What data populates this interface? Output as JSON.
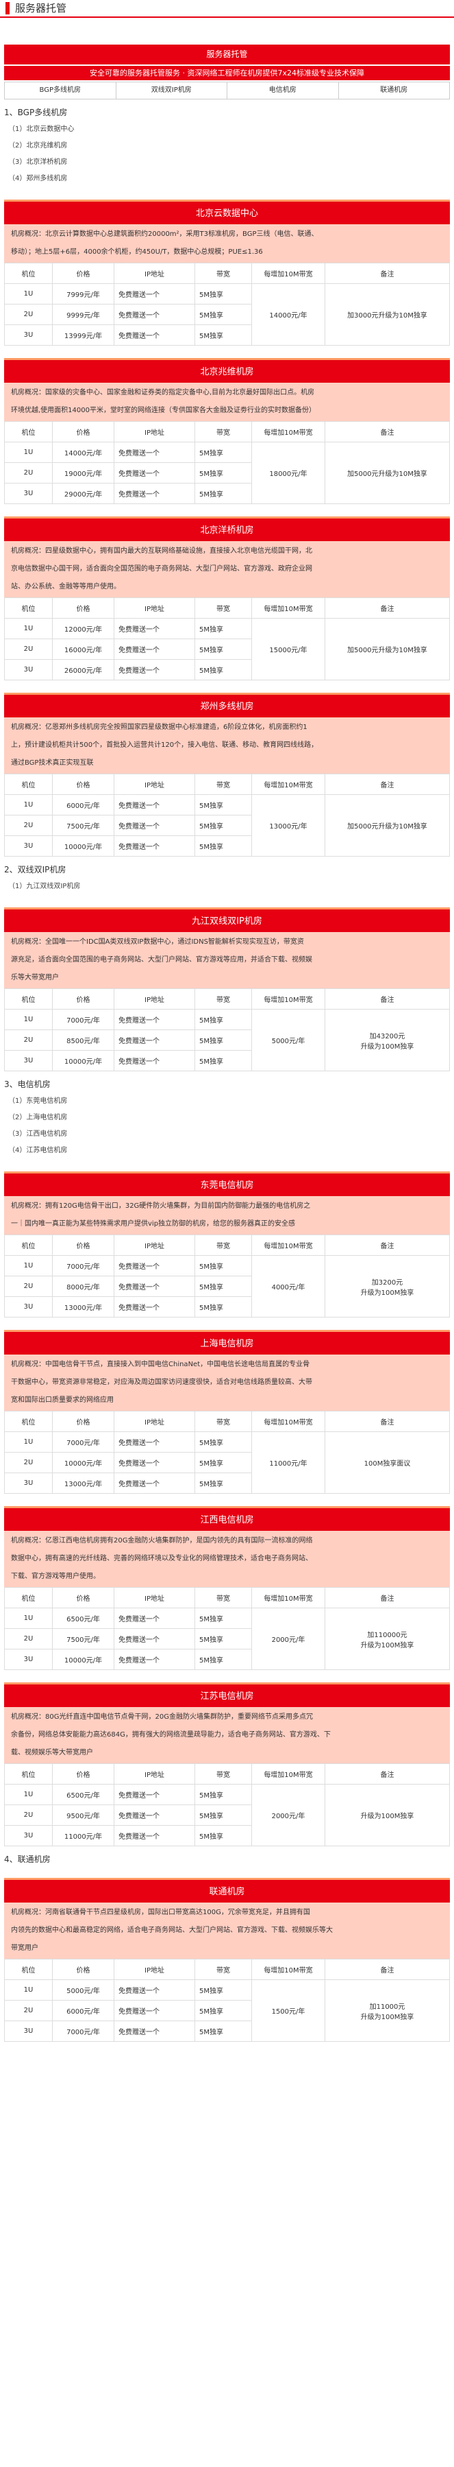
{
  "page": {
    "title": "服务器托管"
  },
  "intro": {
    "heading": "服务器托管",
    "tagline": "安全可靠的服务器托管服务 · 资深网络工程师在机房提供7x24标准级专业技术保障",
    "tabs": [
      "BGP多线机房",
      "双线双IP机房",
      "电信机房",
      "联通机房"
    ]
  },
  "table_headers": [
    "机位",
    "价格",
    "IP地址",
    "带宽",
    "每增加10M带宽",
    "备注"
  ],
  "groups": [
    {
      "title": "1、BGP多线机房",
      "items": [
        "（1）北京云数据中心",
        "（2）北京兆维机房",
        "（3）北京洋桥机房",
        "（4）郑州多线机房"
      ],
      "rooms": [
        {
          "name": "北京云数据中心",
          "desc": [
            "机房概况：北京云计算数据中心总建筑面积约20000m²，采用T3标准机房，BGP三线（电信、联通、",
            "移动）；地上5层+6层，4000余个机柜，约450U/T，数据中心总规模；PUE≤1.36"
          ],
          "rows": [
            {
              "pos": "1U",
              "price": "7999元/年",
              "ip": "免费赠送一个",
              "bw": "5M独享"
            },
            {
              "pos": "2U",
              "price": "9999元/年",
              "ip": "免费赠送一个",
              "bw": "5M独享"
            },
            {
              "pos": "3U",
              "price": "13999元/年",
              "ip": "免费赠送一个",
              "bw": "5M独享"
            }
          ],
          "add": "14000元/年",
          "note": [
            "加3000元升级为10M独享"
          ]
        },
        {
          "name": "北京兆维机房",
          "desc": [
            "机房概况：国家级的灾备中心、国家金融和证券类的指定灾备中心,目前为北京最好国际出口点。机房",
            "环境优越,使用面积14000平米，堂时室的网络连接（专供国家各大金融及证劵行业的实时数据备份）"
          ],
          "rows": [
            {
              "pos": "1U",
              "price": "14000元/年",
              "ip": "免费赠送一个",
              "bw": "5M独享"
            },
            {
              "pos": "2U",
              "price": "19000元/年",
              "ip": "免费赠送一个",
              "bw": "5M独享"
            },
            {
              "pos": "3U",
              "price": "29000元/年",
              "ip": "免费赠送一个",
              "bw": "5M独享"
            }
          ],
          "add": "18000元/年",
          "note": [
            "加5000元升级为10M独享"
          ]
        },
        {
          "name": "北京洋桥机房",
          "desc": [
            "机房概况：四星级数据中心，拥有国内最大的互联网络基础设施，直接接入北京电信光缆国干网，北",
            "京电信数据中心国干网，适合面向全国范围的电子商务网站、大型门户网站、官方游戏、政府企业网",
            "站、办公系统、金融等等用户使用。"
          ],
          "rows": [
            {
              "pos": "1U",
              "price": "12000元/年",
              "ip": "免费赠送一个",
              "bw": "5M独享"
            },
            {
              "pos": "2U",
              "price": "16000元/年",
              "ip": "免费赠送一个",
              "bw": "5M独享"
            },
            {
              "pos": "3U",
              "price": "26000元/年",
              "ip": "免费赠送一个",
              "bw": "5M独享"
            }
          ],
          "add": "15000元/年",
          "note": [
            "加5000元升级为10M独享"
          ]
        },
        {
          "name": "郑州多线机房",
          "desc": [
            "机房概况：亿恩郑州多线机房完全按照国家四星级数据中心标准建造，6阶段立体化，机房面积约1",
            "上，预计建设机柜共计500个，首批投入运营共计120个，接入电信、联通、移动、教育网四线线路，",
            "通过BGP技术真正实现互联"
          ],
          "rows": [
            {
              "pos": "1U",
              "price": "6000元/年",
              "ip": "免费赠送一个",
              "bw": "5M独享"
            },
            {
              "pos": "2U",
              "price": "7500元/年",
              "ip": "免费赠送一个",
              "bw": "5M独享"
            },
            {
              "pos": "3U",
              "price": "10000元/年",
              "ip": "免费赠送一个",
              "bw": "5M独享"
            }
          ],
          "add": "13000元/年",
          "note": [
            "加5000元升级为10M独享"
          ]
        }
      ]
    },
    {
      "title": "2、双线双IP机房",
      "items": [
        "（1）九江双线双IP机房"
      ],
      "rooms": [
        {
          "name": "九江双线双IP机房",
          "desc": [
            "机房概况：全国唯一一个IDC国A类双线双IP数据中心，通过IDNS智能解析实现实现互访，带宽资",
            "源充足，适合面向全国范围的电子商务网站、大型门户网站、官方游戏等应用，并适合下载、视频娱",
            "乐等大带宽用户"
          ],
          "rows": [
            {
              "pos": "1U",
              "price": "7000元/年",
              "ip": "免费赠送一个",
              "bw": "5M独享"
            },
            {
              "pos": "2U",
              "price": "8500元/年",
              "ip": "免费赠送一个",
              "bw": "5M独享"
            },
            {
              "pos": "3U",
              "price": "10000元/年",
              "ip": "免费赠送一个",
              "bw": "5M独享"
            }
          ],
          "add": "5000元/年",
          "note": [
            "加43200元",
            "升级为100M独享"
          ]
        }
      ]
    },
    {
      "title": "3、电信机房",
      "items": [
        "（1）东莞电信机房",
        "（2）上海电信机房",
        "（3）江西电信机房",
        "（4）江苏电信机房"
      ],
      "rooms": [
        {
          "name": "东莞电信机房",
          "desc": [
            "机房概况：拥有120G电信骨干出口，32G硬件防火墙集群，为目前国内防御能力最强的电信机房之",
            "一｜国内唯一真正能为某些特殊需求用户提供vip独立防御的机房，给您的服务器真正的安全感"
          ],
          "rows": [
            {
              "pos": "1U",
              "price": "7000元/年",
              "ip": "免费赠送一个",
              "bw": "5M独享"
            },
            {
              "pos": "2U",
              "price": "8000元/年",
              "ip": "免费赠送一个",
              "bw": "5M独享"
            },
            {
              "pos": "3U",
              "price": "13000元/年",
              "ip": "免费赠送一个",
              "bw": "5M独享"
            }
          ],
          "add": "4000元/年",
          "note": [
            "加3200元",
            "升级为100M独享"
          ]
        },
        {
          "name": "上海电信机房",
          "desc": [
            "机房概况：中国电信骨干节点，直接接入到中国电信ChinaNet，中国电信长途电信局直属的专业骨",
            "干数据中心，带宽资源非常稳定，对应海及周边国家访问速度很快，适合对电信线路质量较高、大带",
            "宽和国际出口质量要求的网络应用"
          ],
          "rows": [
            {
              "pos": "1U",
              "price": "7000元/年",
              "ip": "免费赠送一个",
              "bw": "5M独享"
            },
            {
              "pos": "2U",
              "price": "10000元/年",
              "ip": "免费赠送一个",
              "bw": "5M独享"
            },
            {
              "pos": "3U",
              "price": "13000元/年",
              "ip": "免费赠送一个",
              "bw": "5M独享"
            }
          ],
          "add": "11000元/年",
          "note": [
            "100M独享面议"
          ]
        },
        {
          "name": "江西电信机房",
          "desc": [
            "机房概况：亿恩江西电信机房拥有20G金融防火墙集群防护，是国内领先的具有国际一流标准的网络",
            "数据中心，拥有高速的光纤线路、完善的网络环境以及专业化的网络管理技术，适合电子商务网站、",
            "下载、官方游戏等用户使用。"
          ],
          "rows": [
            {
              "pos": "1U",
              "price": "6500元/年",
              "ip": "免费赠送一个",
              "bw": "5M独享"
            },
            {
              "pos": "2U",
              "price": "7500元/年",
              "ip": "免费赠送一个",
              "bw": "5M独享"
            },
            {
              "pos": "3U",
              "price": "10000元/年",
              "ip": "免费赠送一个",
              "bw": "5M独享"
            }
          ],
          "add": "2000元/年",
          "note": [
            "加110000元",
            "升级为100M独享"
          ]
        },
        {
          "name": "江苏电信机房",
          "desc": [
            "机房概况：80G光纤直连中国电信节点骨干网，20G金融防火墙集群防护，重要网络节点采用多点冗",
            "余备份，网络总体安能能力高达684G，拥有强大的网络流量疏导能力，适合电子商务网站、官方游戏、下",
            "载、视频娱乐等大带宽用户"
          ],
          "rows": [
            {
              "pos": "1U",
              "price": "6500元/年",
              "ip": "免费赠送一个",
              "bw": "5M独享"
            },
            {
              "pos": "2U",
              "price": "9500元/年",
              "ip": "免费赠送一个",
              "bw": "5M独享"
            },
            {
              "pos": "3U",
              "price": "11000元/年",
              "ip": "免费赠送一个",
              "bw": "5M独享"
            }
          ],
          "add": "2000元/年",
          "note": [
            "升级为100M独享"
          ]
        }
      ]
    },
    {
      "title": "4、联通机房",
      "items": [],
      "rooms": [
        {
          "name": "联通机房",
          "desc": [
            "机房概况：河南省联通骨干节点四星级机房，国际出口带宽高达100G，冗余带宽充足，并且拥有国",
            "内领先的数据中心和最高稳定的网络，适合电子商务网站、大型门户网站、官方游戏、下载、视频娱乐等大",
            "带宽用户"
          ],
          "rows": [
            {
              "pos": "1U",
              "price": "5000元/年",
              "ip": "免费赠送一个",
              "bw": "5M独享"
            },
            {
              "pos": "2U",
              "price": "6000元/年",
              "ip": "免费赠送一个",
              "bw": "5M独享"
            },
            {
              "pos": "3U",
              "price": "7000元/年",
              "ip": "免费赠送一个",
              "bw": "5M独享"
            }
          ],
          "add": "1500元/年",
          "note": [
            "加11000元",
            "升级为100M独享"
          ]
        }
      ]
    }
  ]
}
